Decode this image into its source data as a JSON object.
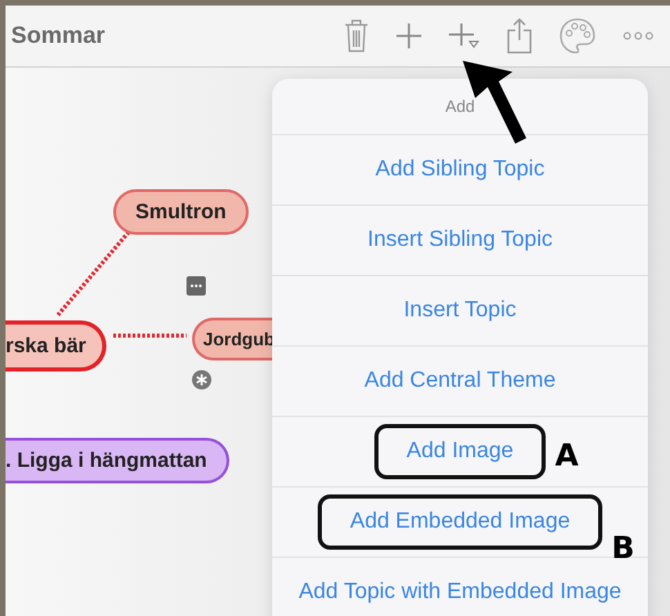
{
  "window": {
    "title": "Sommar"
  },
  "mind_map": {
    "nodes": [
      {
        "label": "Smultron",
        "kind": "branch"
      },
      {
        "label": "rska bär",
        "kind": "main"
      },
      {
        "label": "Jordgub",
        "kind": "branch"
      },
      {
        "label": ". Ligga i hängmattan",
        "kind": "purple"
      }
    ]
  },
  "menu": {
    "title": "Add",
    "items": [
      {
        "label": "Add Sibling Topic"
      },
      {
        "label": "Insert Sibling Topic"
      },
      {
        "label": "Insert Topic"
      },
      {
        "label": "Add Central Theme"
      },
      {
        "label": "Add Image",
        "callout": "A"
      },
      {
        "label": "Add Embedded Image",
        "callout": "B"
      },
      {
        "label": "Add Topic with Embedded Image"
      }
    ]
  }
}
